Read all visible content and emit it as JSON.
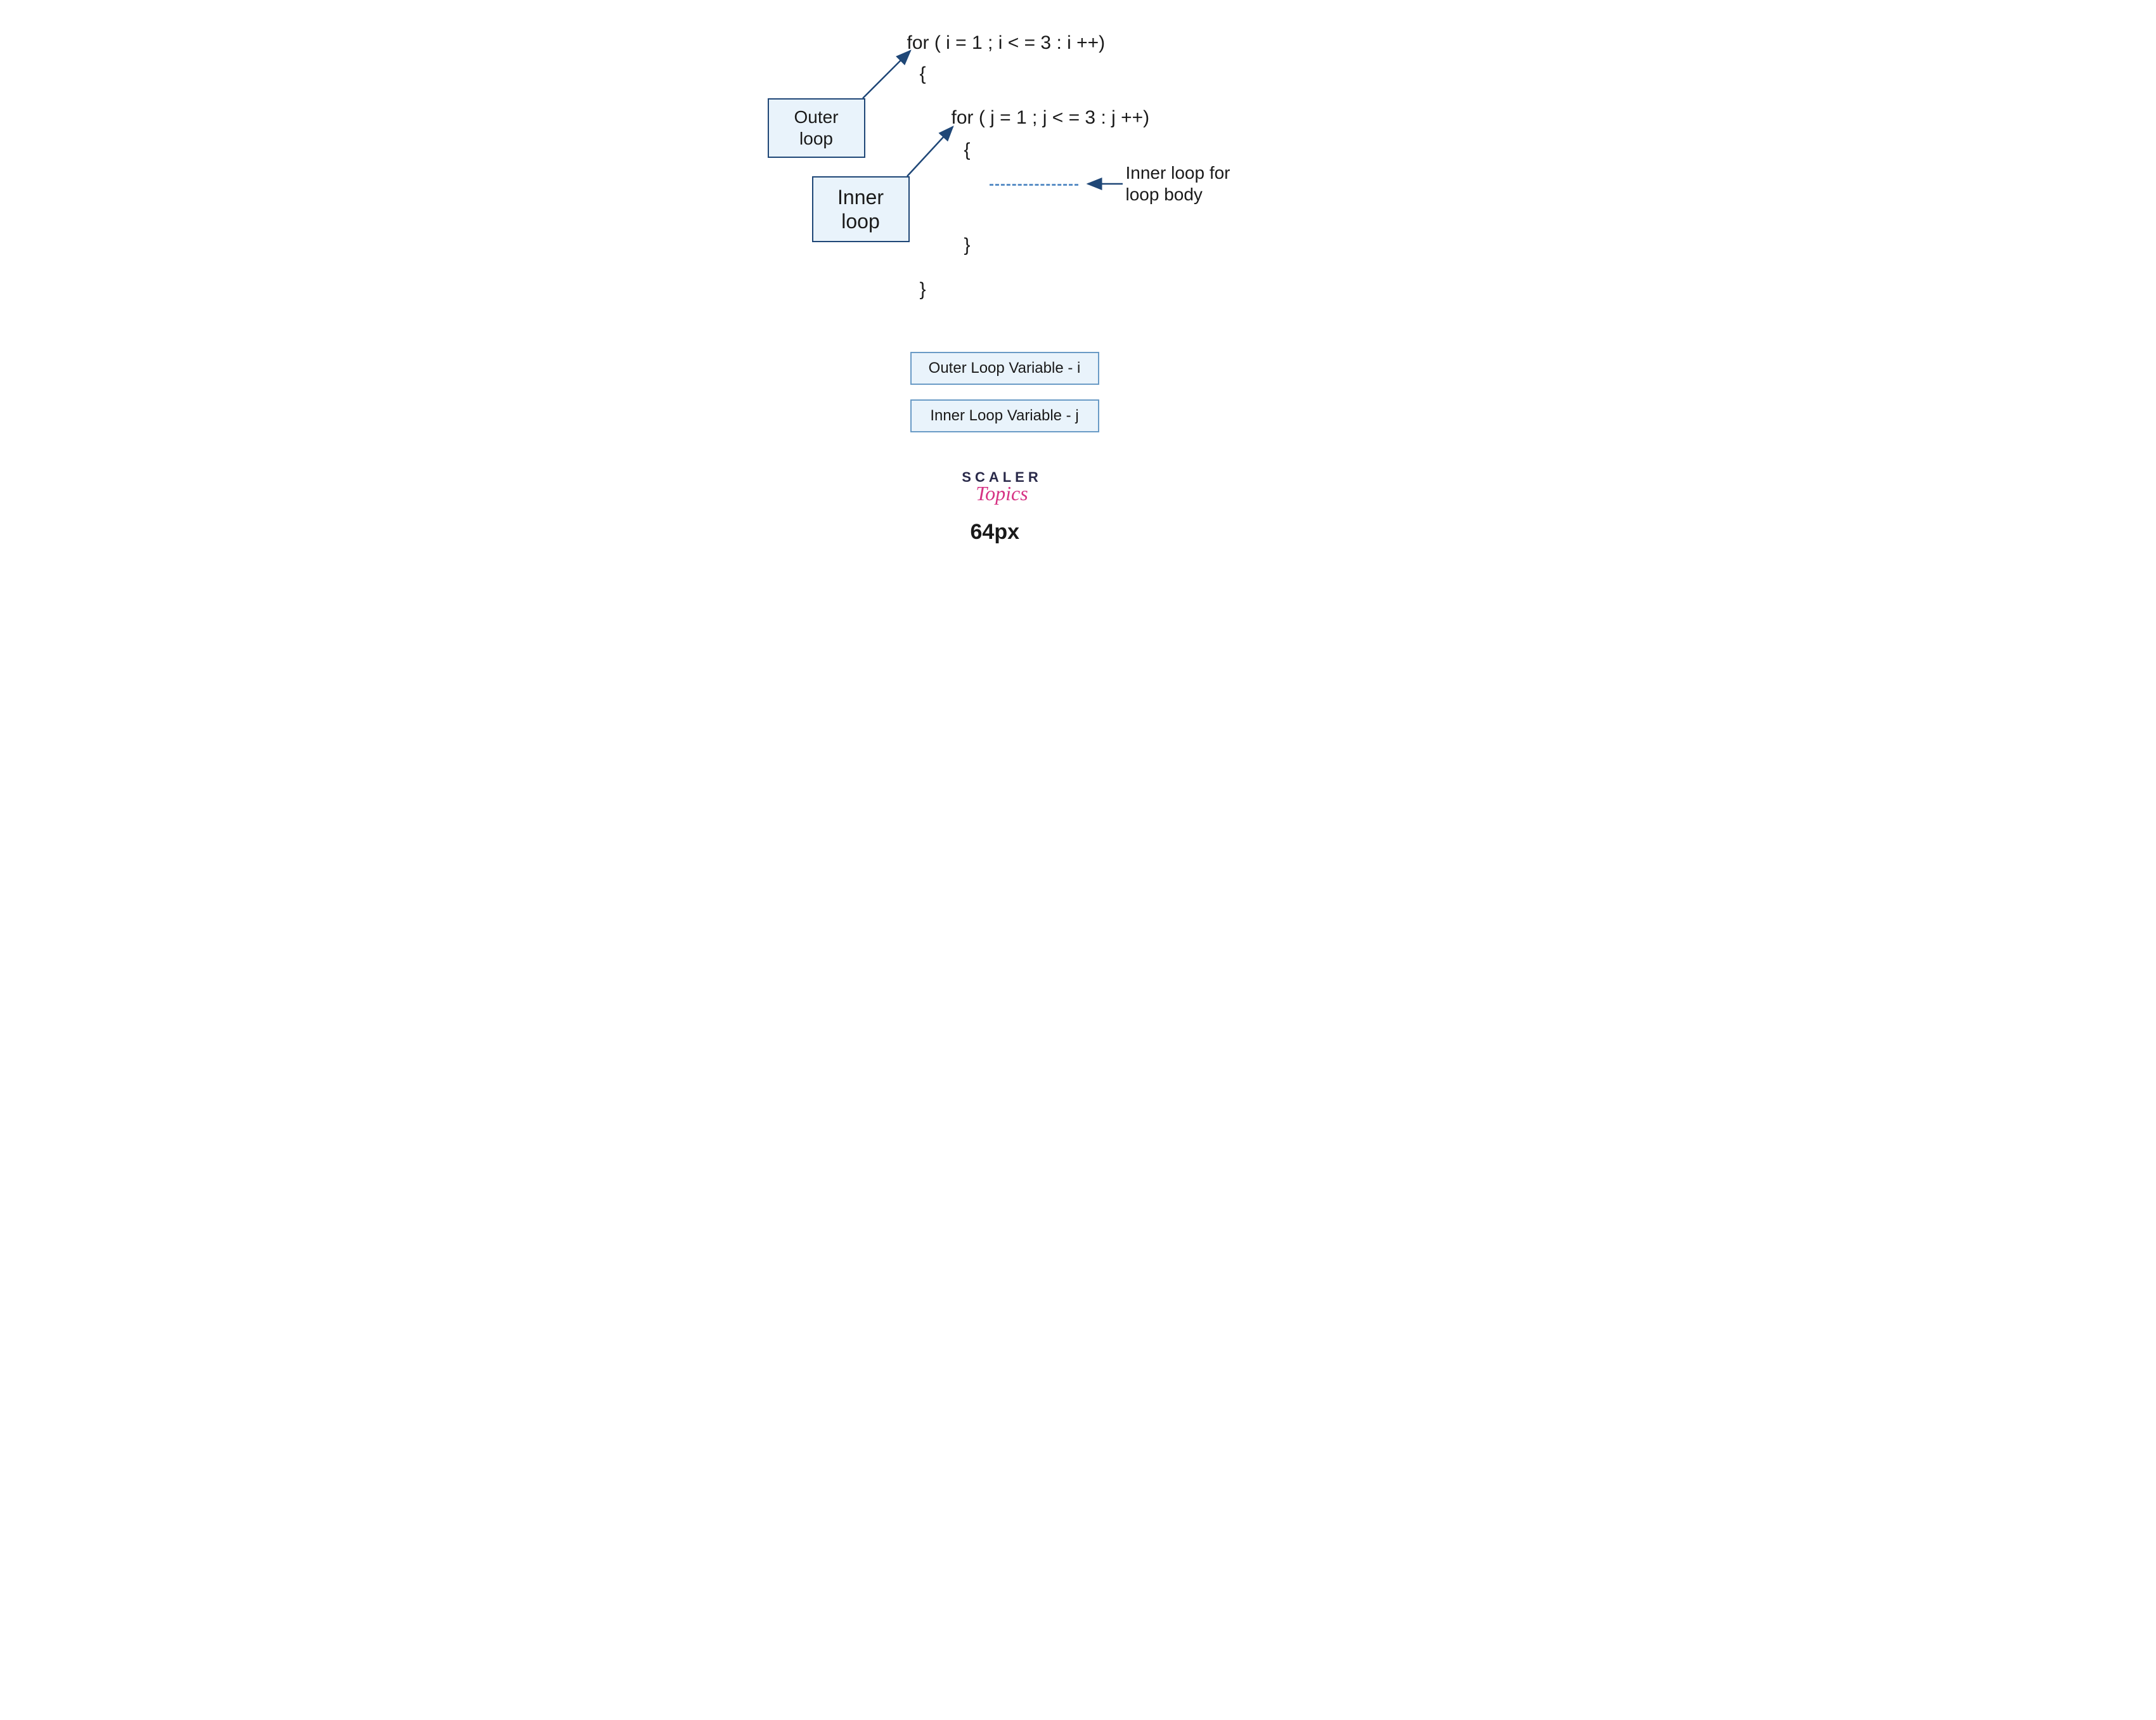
{
  "code": {
    "outer_for": "for ( i = 1 ; i < = 3 : i ++)",
    "outer_open": "{",
    "inner_for": "for ( j = 1 ; j < = 3 : j ++)",
    "inner_open": "{",
    "inner_close": "}",
    "outer_close": "}"
  },
  "labels": {
    "outer_box_l1": "Outer",
    "outer_box_l2": "loop",
    "inner_box_l1": "Inner",
    "inner_box_l2": "loop",
    "body_anno_l1": "Inner loop for",
    "body_anno_l2": "loop body"
  },
  "legend": {
    "outer_var": "Outer Loop Variable - i",
    "inner_var": "Inner Loop Variable - j"
  },
  "logo": {
    "line1": "SCALER",
    "line2": "Topics"
  },
  "footer": {
    "px": "64px"
  },
  "colors": {
    "box_fill": "#e9f3fb",
    "box_border": "#1f4777",
    "arrow": "#1f4777",
    "dash": "#5a8fc6"
  }
}
